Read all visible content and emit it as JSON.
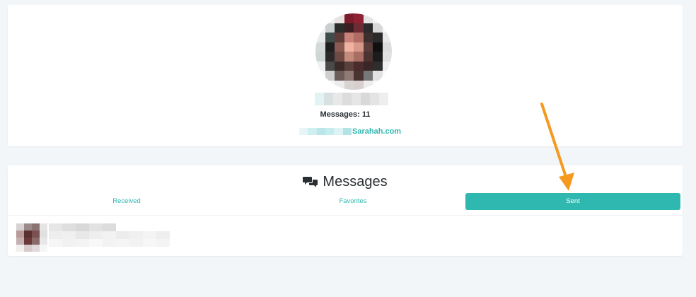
{
  "profile": {
    "messages_count_label": "Messages: 11",
    "profile_link": "Sarahah.com",
    "avatar_pixels": [
      "#ffffff",
      "#f2f2f2",
      "#e9e2e2",
      "#7a1c2a",
      "#8e2233",
      "#e4e4e4",
      "#f4f4f4",
      "#ffffff",
      "#f6f6f6",
      "#c9cfcf",
      "#2c2c2c",
      "#3a1e22",
      "#6d2c33",
      "#2b2b2b",
      "#d8d8d8",
      "#f7f7f7",
      "#e6ecec",
      "#3f4c4a",
      "#5e3a38",
      "#c98278",
      "#b06c63",
      "#3b2f2f",
      "#2a2a2a",
      "#e8e8e8",
      "#d4dada",
      "#1f1f1f",
      "#8a5a52",
      "#f0b3a2",
      "#d7988a",
      "#5a3c38",
      "#101010",
      "#dcdcdc",
      "#cfd6d6",
      "#2a2a2a",
      "#6e4a44",
      "#c48a7b",
      "#a86e63",
      "#4b3431",
      "#1c1c1c",
      "#e1e1e1",
      "#eef1f1",
      "#4a4a4a",
      "#3c2a28",
      "#5a403c",
      "#4a2c2c",
      "#3a2626",
      "#2e2e2e",
      "#f0f0f0",
      "#f9f9f9",
      "#cfcfcf",
      "#6c5c5a",
      "#8f7a76",
      "#4a3432",
      "#777777",
      "#e2e2e2",
      "#fafafa",
      "#ffffff",
      "#f7f7f7",
      "#ececec",
      "#d9d3d2",
      "#d8d0cf",
      "#ededed",
      "#f8f8f8",
      "#ffffff"
    ],
    "name_blur_pixels": [
      "#e2f3f4",
      "#d9e0e1",
      "#e8e8e8",
      "#dcdcdc",
      "#e6e6e6",
      "#d9d9d9",
      "#e4e4e4",
      "#eeeeee"
    ],
    "link_blur_pixels": [
      "#e6f6f6",
      "#cfeef0",
      "#b9e6e8",
      "#c5ecee",
      "#ddf3f4",
      "#b3e3e6"
    ]
  },
  "messages": {
    "title": "Messages",
    "tabs": {
      "received": "Received",
      "favorites": "Favorites",
      "sent": "Sent"
    },
    "item_avatar_pixels": [
      "#d8d2d2",
      "#9a8a8a",
      "#8d7474",
      "#e5e5e5",
      "#b89a9a",
      "#5a3030",
      "#7a5050",
      "#e0e0e0",
      "#c4b0b0",
      "#6a3a3a",
      "#8a6a6a",
      "#e8e8e8",
      "#f2eeee",
      "#d6caca",
      "#e0dada",
      "#f6f6f6"
    ],
    "item_text_pixels": [
      "#e6e6e6",
      "#dedede",
      "#d8d8d8",
      "#e2e2e2",
      "#dcdcdc",
      "#ffffff",
      "#ffffff",
      "#ffffff",
      "#ffffff",
      "#ffffff",
      "#eeeeee",
      "#f0f0f0",
      "#e8e8e8",
      "#eeeeee",
      "#f2f2f2",
      "#ececec",
      "#f0f0f0",
      "#f4f4f4",
      "#eeeeee",
      "#ffffff",
      "#f6f6f6",
      "#f2f2f2",
      "#f4f4f4",
      "#f8f8f8",
      "#f3f3f3",
      "#f5f5f5",
      "#f2f2f2",
      "#f7f7f7",
      "#f4f4f4",
      "#ffffff"
    ]
  },
  "colors": {
    "accent": "#2fb8b0",
    "arrow": "#f5991f",
    "page_bg": "#f3f6f9"
  }
}
